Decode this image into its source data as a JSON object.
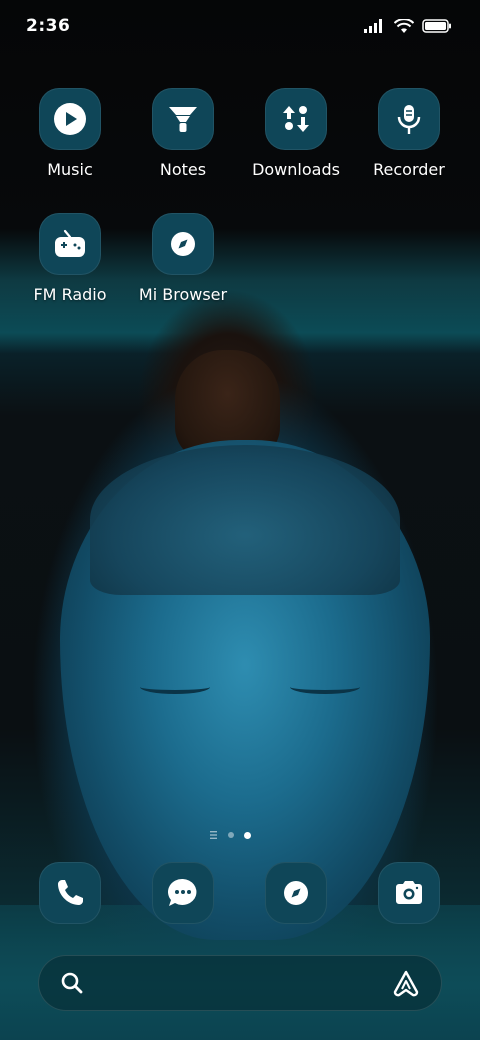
{
  "status_bar": {
    "time": "2:36"
  },
  "apps": [
    {
      "label": "Music",
      "icon": "play-icon"
    },
    {
      "label": "Notes",
      "icon": "notes-icon"
    },
    {
      "label": "Downloads",
      "icon": "download-arrows-icon"
    },
    {
      "label": "Recorder",
      "icon": "microphone-icon"
    },
    {
      "label": "FM Radio",
      "icon": "radio-icon"
    },
    {
      "label": "Mi Browser",
      "icon": "compass-icon"
    }
  ],
  "dock": [
    {
      "icon": "phone-icon"
    },
    {
      "icon": "messages-icon"
    },
    {
      "icon": "compass-icon"
    },
    {
      "icon": "camera-icon"
    }
  ],
  "search": {
    "left_icon": "search-icon",
    "right_icon": "assistant-icon"
  },
  "colors": {
    "icon_background": "#0f4658",
    "accent_teal": "#0c4b56"
  }
}
